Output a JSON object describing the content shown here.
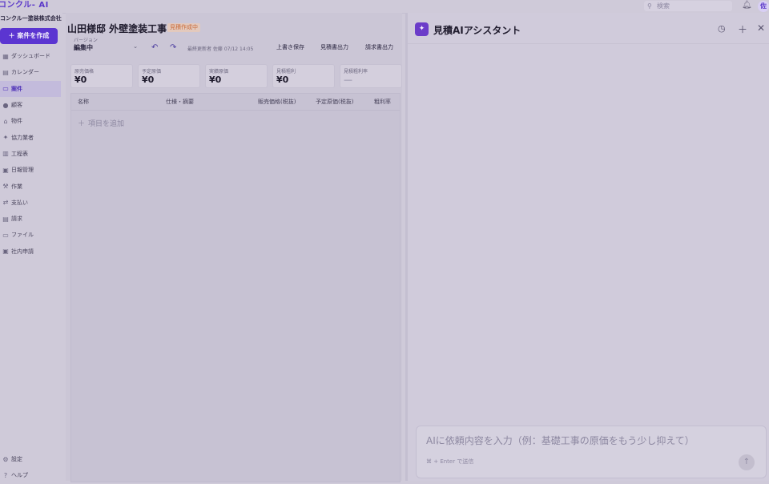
{
  "app": {
    "logo": "コンクル- AI",
    "company": "コンクル一塗装株式会社"
  },
  "topbar": {
    "search_placeholder": "検索",
    "avatar": "佐"
  },
  "sidebar": {
    "new_button": "＋ 案件を作成",
    "items": [
      {
        "label": "ダッシュボード",
        "icon": "▦",
        "active": false
      },
      {
        "label": "カレンダー",
        "icon": "▤",
        "active": false
      },
      {
        "label": "案件",
        "icon": "▭",
        "active": true
      },
      {
        "label": "顧客",
        "icon": "●",
        "active": false
      },
      {
        "label": "物件",
        "icon": "⌂",
        "active": false
      },
      {
        "label": "協力業者",
        "icon": "✦",
        "active": false
      },
      {
        "label": "工程表",
        "icon": "▥",
        "active": false
      },
      {
        "label": "日報管理",
        "icon": "▣",
        "active": false
      },
      {
        "label": "作業",
        "icon": "⚒",
        "active": false
      },
      {
        "label": "支払い",
        "icon": "⇄",
        "active": false
      },
      {
        "label": "請求",
        "icon": "▤",
        "active": false
      },
      {
        "label": "ファイル",
        "icon": "▭",
        "active": false
      },
      {
        "label": "社内申請",
        "icon": "▣",
        "active": false
      }
    ],
    "bottom": [
      {
        "label": "設定",
        "icon": "⚙"
      },
      {
        "label": "ヘルプ",
        "icon": "?"
      }
    ]
  },
  "main": {
    "title": "山田様邸 外壁塗装工事",
    "status": "見積作成中",
    "version_label": "バージョン",
    "version_value": "編集中",
    "updated": "最終更新者 佐藤 07/12 14:05",
    "buttons": {
      "overwrite": "上書き保存",
      "estimate_out": "見積書出力",
      "invoice_out": "請求書出力"
    },
    "cards": [
      {
        "label": "原売価格",
        "value": "¥0"
      },
      {
        "label": "予定原価",
        "value": "¥0"
      },
      {
        "label": "実績原価",
        "value": "¥0"
      },
      {
        "label": "見積粗利",
        "value": "¥0"
      },
      {
        "label": "見積粗利率",
        "value": "—"
      }
    ],
    "table": {
      "headers": [
        "名称",
        "仕様・摘要",
        "販売価格(税抜)",
        "予定原価(税抜)",
        "粗利率"
      ],
      "add_row": "項目を追加"
    }
  },
  "ai": {
    "title": "見積AIアシスタント",
    "placeholder": "AIに依頼内容を入力（例：基礎工事の原価をもう少し抑えて）",
    "hint": "⌘ + Enter で送信"
  },
  "colors": {
    "accent": "#5b35d1",
    "status": "#c96a3a"
  }
}
